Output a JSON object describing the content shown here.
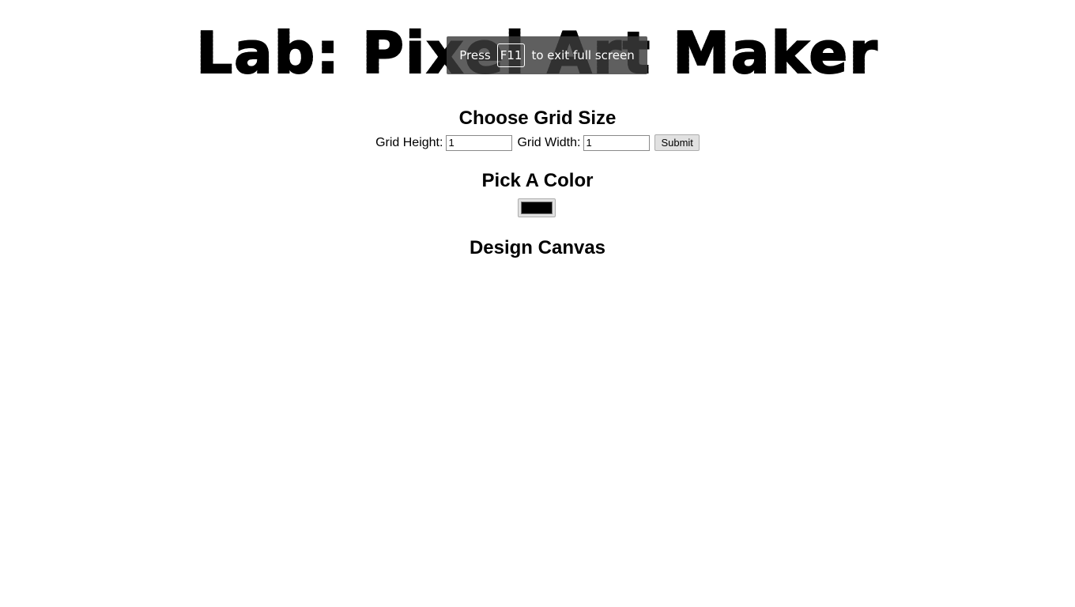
{
  "header": {
    "title": "Lab: Pixel Art Maker"
  },
  "fullscreen_toast": {
    "press": "Press",
    "key": "F11",
    "suffix": "to exit full screen"
  },
  "grid_section": {
    "heading": "Choose Grid Size",
    "height_label": "Grid Height:",
    "height_value": "1",
    "width_label": "Grid Width:",
    "width_value": "1",
    "submit_label": "Submit"
  },
  "color_section": {
    "heading": "Pick A Color",
    "selected_color": "#000000"
  },
  "canvas_section": {
    "heading": "Design Canvas"
  }
}
